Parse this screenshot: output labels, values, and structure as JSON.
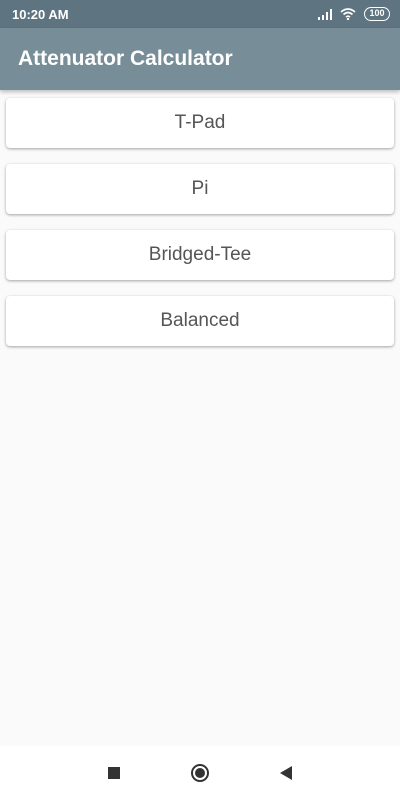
{
  "status_bar": {
    "time": "10:20 AM",
    "battery": "100"
  },
  "app_bar": {
    "title": "Attenuator Calculator"
  },
  "options": [
    {
      "label": "T-Pad"
    },
    {
      "label": "Pi"
    },
    {
      "label": "Bridged-Tee"
    },
    {
      "label": "Balanced"
    }
  ],
  "colors": {
    "status_bar": "#5f7481",
    "app_bar": "#778e99",
    "background": "#fafafa",
    "card": "#ffffff",
    "card_text": "#555555"
  },
  "icons": {
    "status": [
      "signal-icon",
      "wifi-icon",
      "battery-icon"
    ],
    "nav": [
      "recents-icon",
      "home-icon",
      "back-icon"
    ]
  }
}
